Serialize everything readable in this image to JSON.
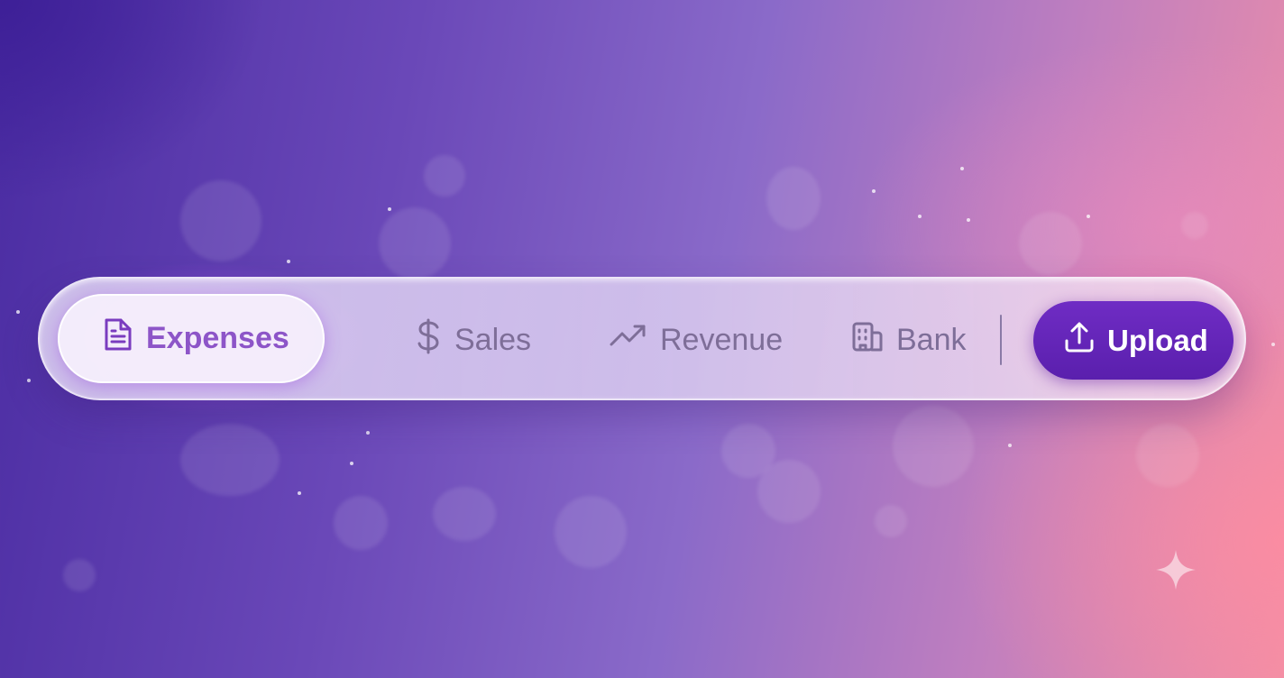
{
  "toolbar": {
    "tabs": [
      {
        "label": "Expenses",
        "icon": "document-icon",
        "active": true
      },
      {
        "label": "Sales",
        "icon": "dollar-icon",
        "active": false
      },
      {
        "label": "Revenue",
        "icon": "trending-up-icon",
        "active": false
      },
      {
        "label": "Bank",
        "icon": "building-icon",
        "active": false
      }
    ],
    "upload": {
      "label": "Upload",
      "icon": "upload-icon"
    }
  },
  "colors": {
    "accent": "#6a28bf",
    "active_text": "#8d55c8",
    "inactive_text": "#7e6e98",
    "background_start": "#4a2ca2",
    "background_end": "#f08fa6"
  },
  "decorations": {
    "sparkle_icon": "sparkle-icon"
  }
}
